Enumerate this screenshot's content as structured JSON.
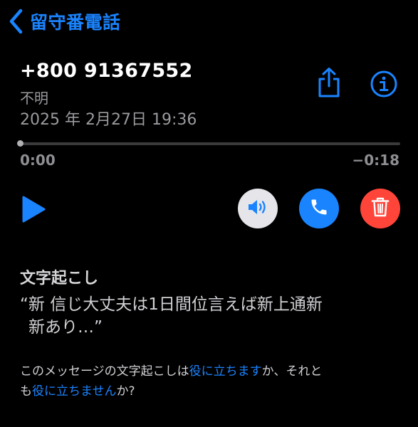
{
  "nav": {
    "back_label": "留守番電話"
  },
  "voicemail": {
    "caller": "+800 91367552",
    "caller_sub": "不明",
    "date": "2025 年 2月27日 19:36"
  },
  "player": {
    "elapsed": "0:00",
    "remaining": "−0:18",
    "progress": 0.0
  },
  "transcription": {
    "title": "文字起こし",
    "line1": "“新 信じ大丈夫は1日間位言えば新上通新",
    "line2": "新あり…”"
  },
  "feedback": {
    "prefix": "このメッセージの文字起こしは",
    "useful": "役に立ちます",
    "middle_a": "か、それと",
    "middle_b": "も",
    "not_useful": "役に立ちません",
    "suffix": "か?"
  },
  "colors": {
    "accent": "#1a84ff",
    "delete": "#ff453a",
    "speaker_bg": "#e5e5ea"
  },
  "icons": {
    "back": "chevron-left-icon",
    "share": "share-icon",
    "info": "info-icon",
    "play": "play-icon",
    "speaker": "speaker-icon",
    "call": "phone-icon",
    "delete": "trash-icon"
  }
}
